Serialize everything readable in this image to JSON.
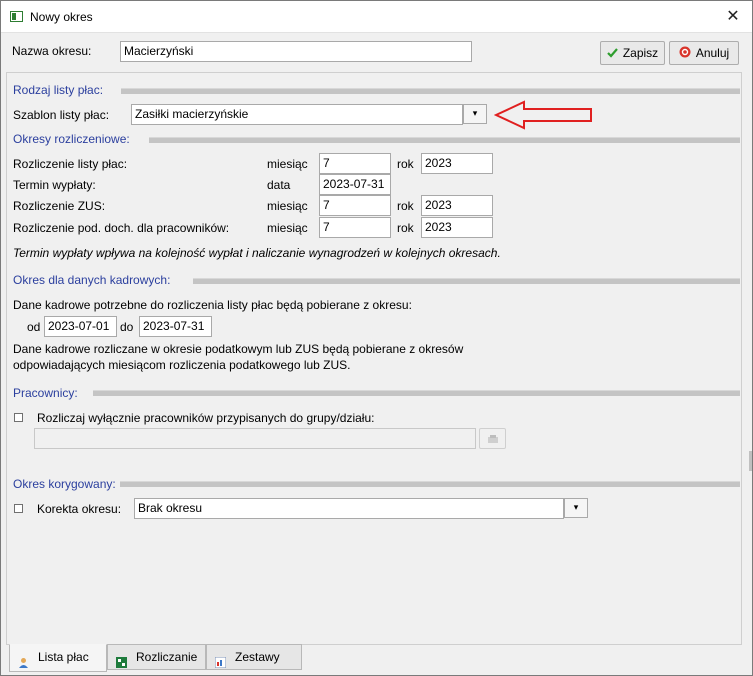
{
  "window": {
    "title": "Nowy okres",
    "close_glyph": "✕"
  },
  "header": {
    "name_label": "Nazwa okresu:",
    "name_value": "Macierzyński",
    "save_label": "Zapisz",
    "cancel_label": "Anuluj"
  },
  "payroll_type": {
    "section_title": "Rodzaj listy płac:",
    "template_label": "Szablon listy płac:",
    "template_value": "Zasiłki macierzyńskie"
  },
  "settlement": {
    "section_title": "Okresy rozliczeniowe:",
    "rows": [
      {
        "label": "Rozliczenie listy płac:",
        "unit1": "miesiąc",
        "value1": "7",
        "unit2": "rok",
        "value2": "2023"
      },
      {
        "label": "Termin wypłaty:",
        "unit1": "data",
        "value1": "2023-07-31"
      },
      {
        "label": "Rozliczenie ZUS:",
        "unit1": "miesiąc",
        "value1": "7",
        "unit2": "rok",
        "value2": "2023"
      },
      {
        "label": "Rozliczenie pod. doch. dla pracowników:",
        "unit1": "miesiąc",
        "value1": "7",
        "unit2": "rok",
        "value2": "2023"
      }
    ],
    "note": "Termin wypłaty wpływa na kolejność wypłat i naliczanie wynagrodzeń w kolejnych okresach."
  },
  "hr_period": {
    "section_title": "Okres dla danych kadrowych:",
    "description": "Dane kadrowe potrzebne do rozliczenia listy płac będą pobierane z okresu:",
    "from_label": "od",
    "from_value": "2023-07-01",
    "to_label": "do",
    "to_value": "2023-07-31",
    "note_line1": "Dane kadrowe rozliczane w okresie podatkowym lub ZUS będą pobierane z okresów",
    "note_line2": "odpowiadających miesiącom rozliczenia podatkowego lub ZUS."
  },
  "employees": {
    "section_title": "Pracownicy:",
    "checkbox_label": "Rozliczaj wyłącznie pracowników przypisanych do grupy/działu:",
    "checkbox_checked": false,
    "group_value": ""
  },
  "correction": {
    "section_title": "Okres korygowany:",
    "checkbox_label": "Korekta okresu:",
    "checkbox_checked": false,
    "select_value": "Brak okresu"
  },
  "tabs": [
    {
      "label": "Lista płac",
      "active": true
    },
    {
      "label": "Rozliczanie",
      "active": false
    },
    {
      "label": "Zestawy",
      "active": false
    }
  ],
  "annotation": {
    "arrow_color": "#e02020"
  }
}
